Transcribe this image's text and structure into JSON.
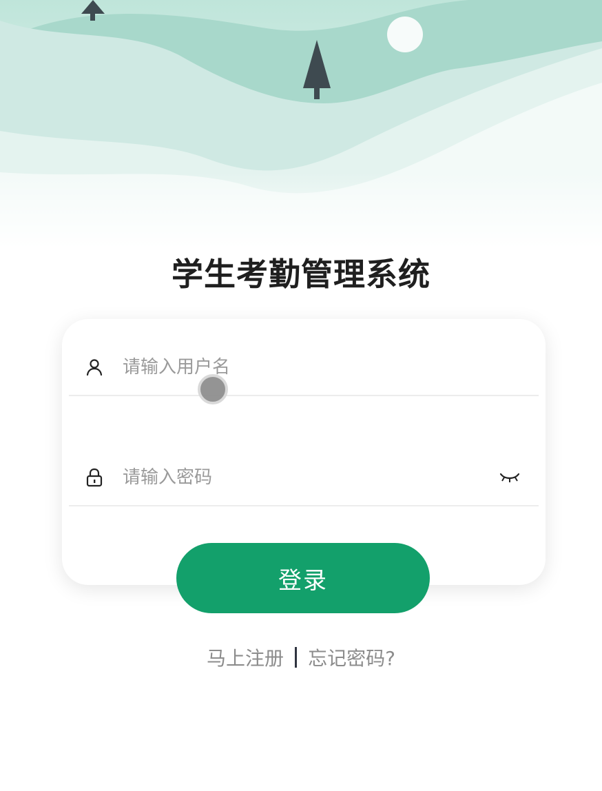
{
  "app": {
    "title": "学生考勤管理系统"
  },
  "login_form": {
    "username": {
      "value": "",
      "placeholder": "请输入用户名",
      "icon": "user-icon"
    },
    "password": {
      "value": "",
      "placeholder": "请输入密码",
      "icon": "lock-icon",
      "visibility_icon": "eye-closed-icon"
    },
    "submit_label": "登录"
  },
  "links": {
    "register_label": "马上注册",
    "forgot_label": "忘记密码?"
  },
  "colors": {
    "primary": "#13a06b",
    "title_text": "#1f1f1f",
    "placeholder": "#9a9a9a",
    "link_text": "#8c8c8c",
    "separator": "#2f3440"
  }
}
